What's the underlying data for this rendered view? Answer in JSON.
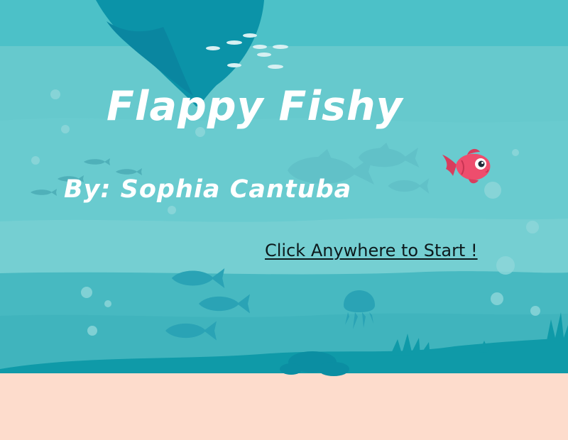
{
  "game": {
    "title": "Flappy Fishy",
    "author": "By: Sophia Cantuba",
    "start_prompt": "Click Anywhere to Start !"
  },
  "colors": {
    "water_top": "#4cc1c8",
    "water_mid": "#66c9cd",
    "water_band": "#75cfd2",
    "water_deep": "#47b9c1",
    "seabed": "#0f9aa8",
    "sand": "#fddccc",
    "rock": "#0b93a8",
    "player_fish": "#ee4d6d",
    "text": "#ffffff",
    "start_text": "#0d1a1d"
  },
  "icons": {
    "player": "fish-icon",
    "background_fish": "fish-silhouette-icon",
    "jellyfish": "jellyfish-icon",
    "seaweed": "seaweed-icon"
  }
}
